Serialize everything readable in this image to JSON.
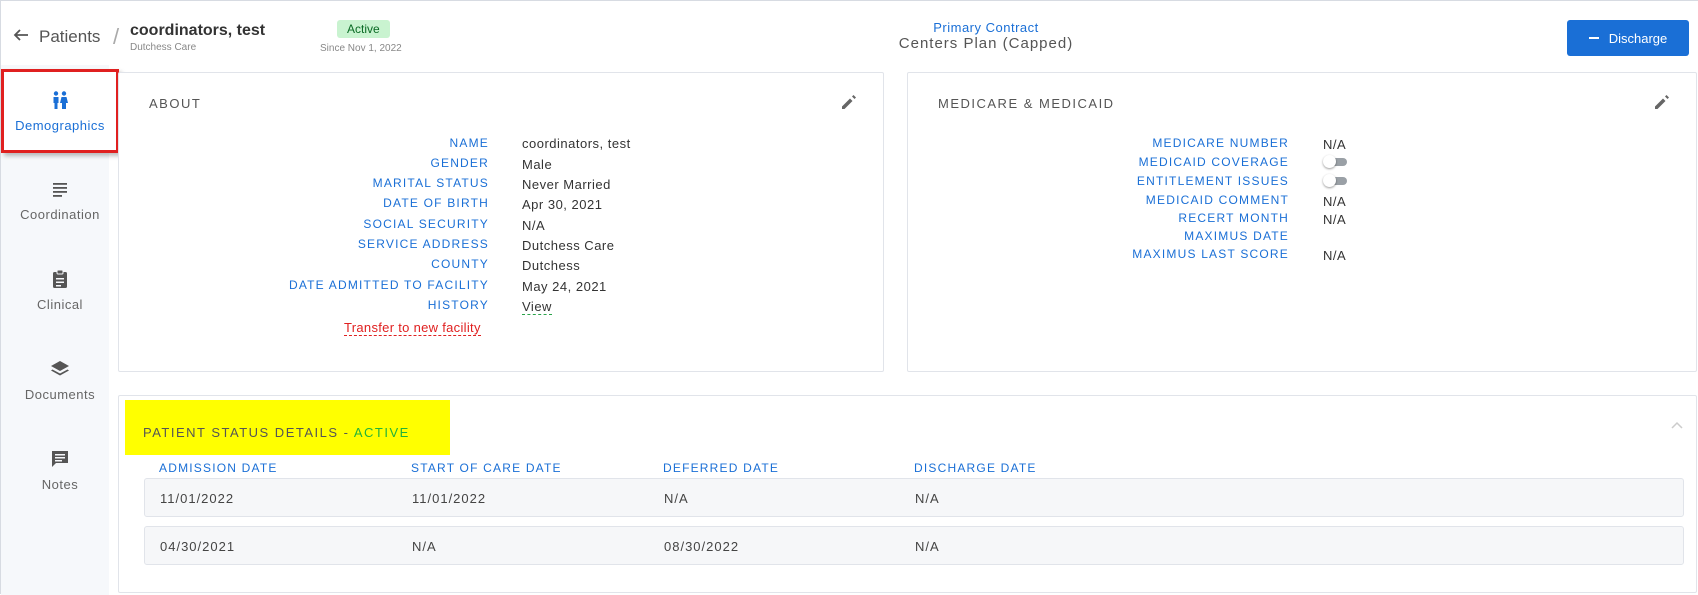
{
  "header": {
    "back_label": "Patients",
    "separator": "/",
    "patient_name": "coordinators, test",
    "facility": "Dutchess Care",
    "status_badge": "Active",
    "since": "Since Nov 1, 2022",
    "contract_label": "Primary Contract",
    "contract_value": "Centers Plan (Capped)",
    "discharge_label": "Discharge",
    "status_badge_color": "#c9f3d0",
    "accent_color": "#1a6fd6"
  },
  "sidebar": {
    "items": [
      {
        "label": "Demographics",
        "icon": "people-icon",
        "active": true
      },
      {
        "label": "Coordination",
        "icon": "list-lines-icon",
        "active": false
      },
      {
        "label": "Clinical",
        "icon": "clipboard-icon",
        "active": false
      },
      {
        "label": "Documents",
        "icon": "layers-icon",
        "active": false
      },
      {
        "label": "Notes",
        "icon": "comment-icon",
        "active": false
      }
    ]
  },
  "about": {
    "title": "ABOUT",
    "fields": [
      {
        "label": "NAME",
        "value": "coordinators, test"
      },
      {
        "label": "GENDER",
        "value": "Male"
      },
      {
        "label": "MARITAL STATUS",
        "value": "Never Married"
      },
      {
        "label": "DATE OF BIRTH",
        "value": "Apr 30, 2021"
      },
      {
        "label": "SOCIAL SECURITY",
        "value": "N/A"
      },
      {
        "label": "SERVICE ADDRESS",
        "value": "Dutchess Care"
      },
      {
        "label": "COUNTY",
        "value": "Dutchess"
      },
      {
        "label": "DATE ADMITTED TO FACILITY",
        "value": "May 24, 2021"
      },
      {
        "label": "HISTORY",
        "value": "View"
      }
    ],
    "transfer_link": "Transfer to new facility"
  },
  "medicare": {
    "title": "MEDICARE & MEDICAID",
    "fields": [
      {
        "label": "MEDICARE NUMBER",
        "value": "N/A"
      },
      {
        "label": "MEDICAID COVERAGE",
        "value": ""
      },
      {
        "label": "ENTITLEMENT ISSUES",
        "value": ""
      },
      {
        "label": "MEDICAID COMMENT",
        "value": "N/A"
      },
      {
        "label": "RECERT MONTH",
        "value": "N/A"
      },
      {
        "label": "MAXIMUS DATE",
        "value": ""
      },
      {
        "label": "MAXIMUS LAST SCORE",
        "value": "N/A"
      }
    ],
    "toggles": {
      "medicaid_coverage": false,
      "entitlement_issues": false
    }
  },
  "status_details": {
    "title_prefix": "PATIENT STATUS DETAILS - ",
    "title_status": "ACTIVE",
    "highlight_color": "#ffff00",
    "columns": [
      "ADMISSION DATE",
      "START OF CARE DATE",
      "DEFERRED DATE",
      "DISCHARGE DATE"
    ],
    "rows": [
      [
        "11/01/2022",
        "11/01/2022",
        "N/A",
        "N/A"
      ],
      [
        "04/30/2021",
        "N/A",
        "08/30/2022",
        "N/A"
      ]
    ]
  }
}
